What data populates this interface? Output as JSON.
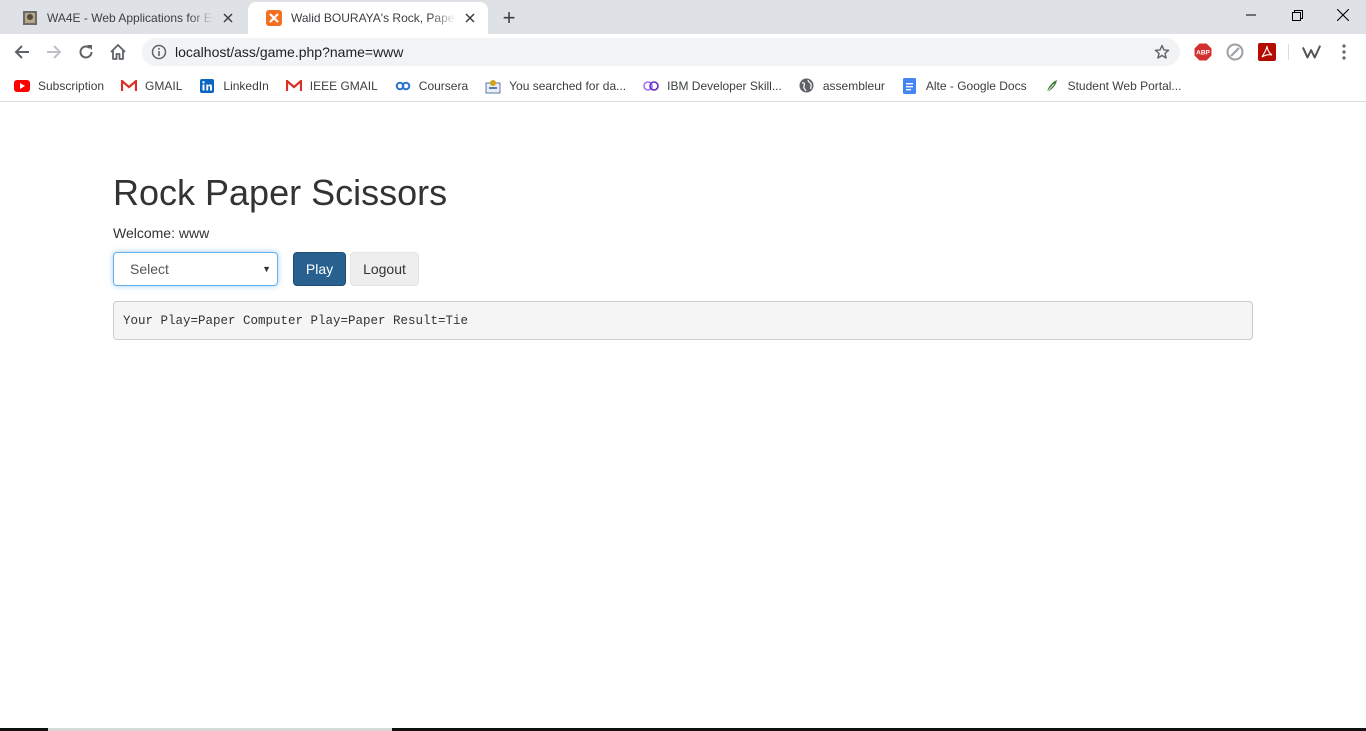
{
  "browser": {
    "tabs": [
      {
        "title": "WA4E - Web Applications for Everybody",
        "active": false
      },
      {
        "title": "Walid BOURAYA's Rock, Paper, Scissors Game",
        "active": true
      }
    ],
    "new_tab_symbol": "+",
    "address": {
      "url": "localhost/ass/game.php?name=www"
    },
    "extensions": [
      "adblock-plus-icon",
      "extension-gray-icon",
      "adobe-acrobat-icon",
      "wolfram-icon",
      "more-menu-icon"
    ],
    "bookmarks": [
      {
        "label": "Subscription",
        "icon": "youtube-icon"
      },
      {
        "label": "GMAIL",
        "icon": "gmail-icon"
      },
      {
        "label": "LinkedIn",
        "icon": "linkedin-icon"
      },
      {
        "label": "IEEE GMAIL",
        "icon": "gmail-icon"
      },
      {
        "label": "Coursera",
        "icon": "coursera-icon"
      },
      {
        "label": "You searched for da...",
        "icon": "site-icon"
      },
      {
        "label": "IBM Developer Skill...",
        "icon": "ibm-icon"
      },
      {
        "label": "assembleur",
        "icon": "globe-icon"
      },
      {
        "label": "Alte - Google Docs",
        "icon": "google-docs-icon"
      },
      {
        "label": "Student Web Portal...",
        "icon": "leaf-icon"
      }
    ]
  },
  "page": {
    "heading": "Rock Paper Scissors",
    "welcome_label": "Welcome:",
    "welcome_name": "www",
    "select_value": "Select",
    "play_label": "Play",
    "logout_label": "Logout",
    "result_text": "Your Play=Paper Computer Play=Paper Result=Tie"
  },
  "colors": {
    "play_button": "#286090",
    "select_focus": "#66afe9",
    "result_background": "#f5f5f5"
  }
}
